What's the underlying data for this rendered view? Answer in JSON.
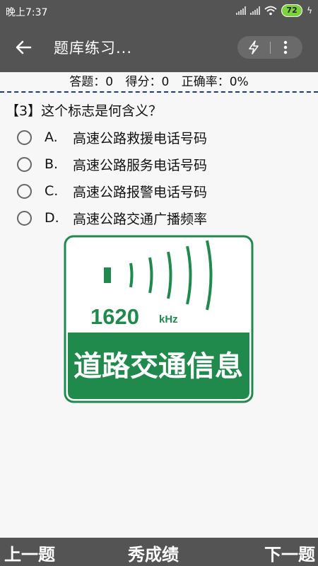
{
  "status": {
    "time": "晚上7:37",
    "battery": "72"
  },
  "appbar": {
    "title": "题库练习..."
  },
  "stats": {
    "answered": "答题：0",
    "score": "得分：0",
    "accuracy": "正确率：0%"
  },
  "question": {
    "number_text": "【3】这个标志是何含义？",
    "options": [
      {
        "letter": "A.",
        "text": "高速公路救援电话号码"
      },
      {
        "letter": "B.",
        "text": "高速公路服务电话号码"
      },
      {
        "letter": "C.",
        "text": "高速公路报警电话号码"
      },
      {
        "letter": "D.",
        "text": "高速公路交通广播频率"
      }
    ]
  },
  "sign": {
    "frequency": "1620",
    "unit": "kHz",
    "caption": "道路交通信息",
    "color": "#1f8a4c"
  },
  "bottom": {
    "prev": "上一题",
    "score": "秀成绩",
    "next": "下一题"
  }
}
